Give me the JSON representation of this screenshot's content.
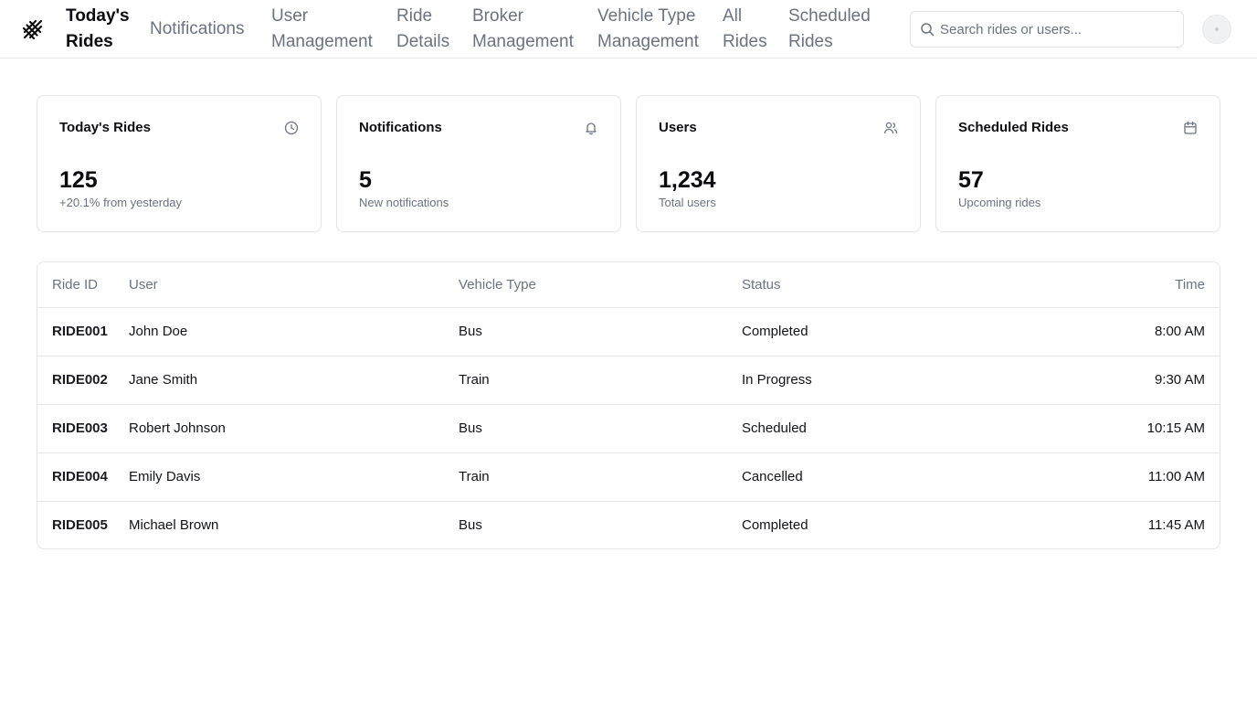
{
  "app": {
    "logo_icon": "railway-track-icon"
  },
  "nav": {
    "items": [
      {
        "label": "Today's",
        "label2": "Rides",
        "active": true
      },
      {
        "label": "Notifications",
        "label2": "",
        "active": false
      },
      {
        "label": "User",
        "label2": "Management",
        "active": false
      },
      {
        "label": "Ride",
        "label2": "Details",
        "active": false
      },
      {
        "label": "Broker",
        "label2": "Management",
        "active": false
      },
      {
        "label": "Vehicle Type",
        "label2": "Management",
        "active": false
      },
      {
        "label": "All",
        "label2": "Rides",
        "active": false
      },
      {
        "label": "Scheduled",
        "label2": "Rides",
        "active": false
      }
    ]
  },
  "search": {
    "placeholder": "Search rides or users...",
    "value": ""
  },
  "cards": [
    {
      "title": "Today's Rides",
      "value": "125",
      "sub": "+20.1% from yesterday",
      "icon": "clock-icon"
    },
    {
      "title": "Notifications",
      "value": "5",
      "sub": "New notifications",
      "icon": "bell-icon"
    },
    {
      "title": "Users",
      "value": "1,234",
      "sub": "Total users",
      "icon": "users-icon"
    },
    {
      "title": "Scheduled Rides",
      "value": "57",
      "sub": "Upcoming rides",
      "icon": "calendar-icon"
    }
  ],
  "table": {
    "headers": [
      "Ride ID",
      "User",
      "Vehicle Type",
      "Status",
      "Time"
    ],
    "rows": [
      [
        "RIDE001",
        "John Doe",
        "Bus",
        "Completed",
        "8:00 AM"
      ],
      [
        "RIDE002",
        "Jane Smith",
        "Train",
        "In Progress",
        "9:30 AM"
      ],
      [
        "RIDE003",
        "Robert Johnson",
        "Bus",
        "Scheduled",
        "10:15 AM"
      ],
      [
        "RIDE004",
        "Emily Davis",
        "Train",
        "Cancelled",
        "11:00 AM"
      ],
      [
        "RIDE005",
        "Michael Brown",
        "Bus",
        "Completed",
        "11:45 AM"
      ]
    ]
  }
}
